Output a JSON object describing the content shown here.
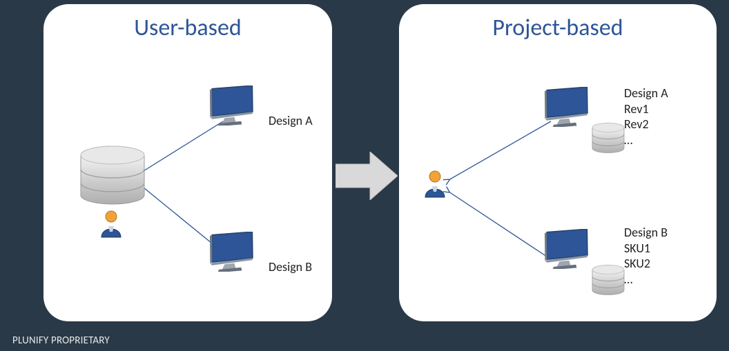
{
  "left_panel": {
    "title": "User-based",
    "labels": {
      "top": "Design A",
      "bottom": "Design B"
    }
  },
  "right_panel": {
    "title": "Project-based",
    "labels": {
      "top": "Design A\nRev1\nRev2\n…",
      "bottom": "Design B\nSKU1\nSKU2\n…"
    }
  },
  "footer": "PLUNIFY PROPRIETARY",
  "icons": {
    "monitor": "monitor-icon",
    "user": "user-icon",
    "database": "database-icon",
    "arrow": "arrow-right-icon"
  }
}
